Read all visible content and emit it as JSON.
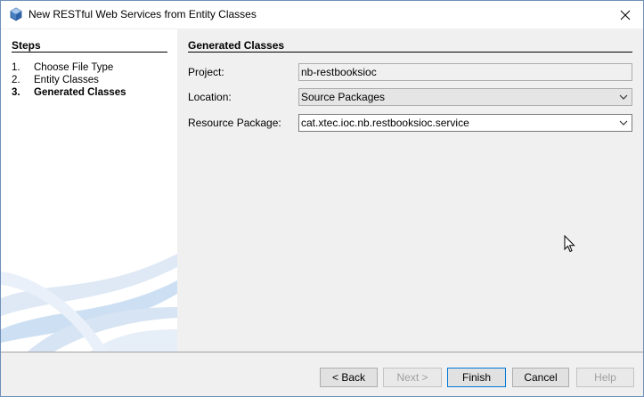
{
  "window": {
    "title": "New RESTful Web Services from Entity Classes"
  },
  "steps": {
    "heading": "Steps",
    "items": [
      {
        "num": "1.",
        "label": "Choose File Type",
        "active": false
      },
      {
        "num": "2.",
        "label": "Entity Classes",
        "active": false
      },
      {
        "num": "3.",
        "label": "Generated Classes",
        "active": true
      }
    ]
  },
  "panel": {
    "heading": "Generated Classes",
    "project_label": "Project:",
    "project_value": "nb-restbooksioc",
    "location_label": "Location:",
    "location_value": "Source Packages",
    "package_label": "Resource Package:",
    "package_value": "cat.xtec.ioc.nb.restbooksioc.service"
  },
  "buttons": {
    "back": "< Back",
    "next": "Next >",
    "finish": "Finish",
    "cancel": "Cancel",
    "help": "Help"
  },
  "icons": {
    "app": "netbeans-cube-icon",
    "close": "close-icon",
    "dropdown": "chevron-down-icon"
  },
  "colors": {
    "accent": "#0078d7",
    "panel_left": "#ffffff",
    "panel_right": "#f0f0f0"
  }
}
